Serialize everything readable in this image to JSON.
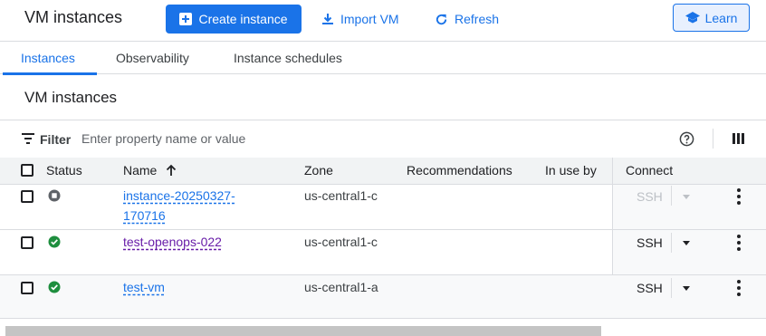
{
  "header": {
    "title": "VM instances",
    "create_label": "Create instance",
    "import_label": "Import VM",
    "refresh_label": "Refresh",
    "learn_label": "Learn"
  },
  "tabs": [
    {
      "label": "Instances",
      "active": true
    },
    {
      "label": "Observability",
      "active": false
    },
    {
      "label": "Instance schedules",
      "active": false
    }
  ],
  "section_title": "VM instances",
  "filter": {
    "label": "Filter",
    "placeholder": "Enter property name or value"
  },
  "table": {
    "columns": [
      "Status",
      "Name",
      "Zone",
      "Recommendations",
      "In use by",
      "Connect"
    ],
    "sort_icon": "arrow-up-icon",
    "rows": [
      {
        "status": "stopped",
        "name_line1": "instance-20250327-",
        "name_line2": "170716",
        "zone": "us-central1-c",
        "connect": "SSH",
        "connect_enabled": false
      },
      {
        "status": "running",
        "name_line1": "test-openops-022",
        "name_line2": "",
        "zone": "us-central1-c",
        "connect": "SSH",
        "connect_enabled": true
      },
      {
        "status": "running",
        "name_line1": "test-vm",
        "name_line2": "",
        "zone": "us-central1-a",
        "connect": "SSH",
        "connect_enabled": true
      }
    ]
  },
  "colors": {
    "primary": "#1a73e8",
    "running": "#1e8e3e",
    "stopped": "#5f6368",
    "visited_link": "#681da8"
  }
}
